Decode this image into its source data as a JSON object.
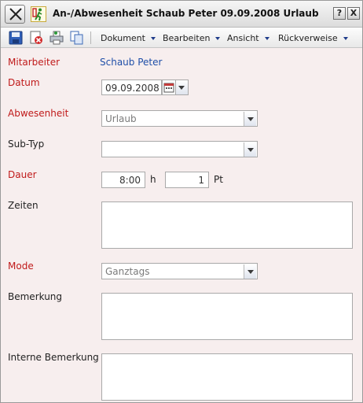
{
  "window": {
    "title": "An-/Abwesenheit Schaub Peter 09.09.2008 Urlaub",
    "help_label": "?",
    "close_label": "X"
  },
  "toolbar": {
    "icons": [
      "save-icon",
      "delete-icon",
      "print-icon",
      "copy-icon"
    ],
    "menus": [
      "Dokument",
      "Bearbeiten",
      "Ansicht",
      "Rückverweise"
    ]
  },
  "form": {
    "mitarbeiter": {
      "label": "Mitarbeiter",
      "value": "Schaub Peter"
    },
    "datum": {
      "label": "Datum",
      "value": "09.09.2008"
    },
    "abwesenheit": {
      "label": "Abwesenheit",
      "value": "Urlaub"
    },
    "subtyp": {
      "label": "Sub-Typ",
      "value": ""
    },
    "dauer": {
      "label": "Dauer",
      "hours": "8:00",
      "hours_unit": "h",
      "points": "1",
      "points_unit": "Pt"
    },
    "zeiten": {
      "label": "Zeiten",
      "value": ""
    },
    "mode": {
      "label": "Mode",
      "value": "Ganztags"
    },
    "bemerkung": {
      "label": "Bemerkung",
      "value": ""
    },
    "interne_bemerkung": {
      "label": "Interne Bemerkung",
      "value": ""
    }
  },
  "colors": {
    "required_label": "#c01a1a",
    "link": "#1f4fa8",
    "form_background": "#f7eeee"
  }
}
